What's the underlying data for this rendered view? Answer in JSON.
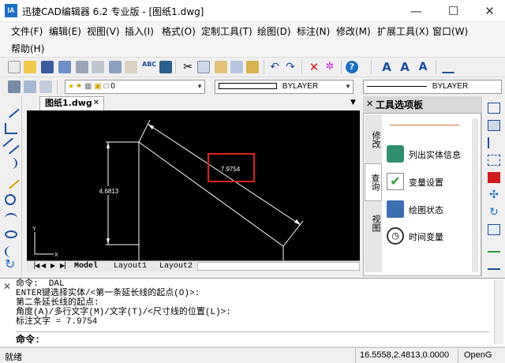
{
  "window": {
    "title": "迅捷CAD编辑器 6.2 专业版  - [图纸1.dwg]",
    "app_icon_text": "IA",
    "minimize": "—",
    "maximize": "☐",
    "close": "✕"
  },
  "menu": {
    "items": [
      "文件(F)",
      "编辑(E)",
      "视图(V)",
      "插入(I)",
      "格式(O)",
      "定制工具(T)",
      "绘图(D)",
      "标注(N)",
      "修改(M)",
      "扩展工具(X)",
      "窗口(W)",
      "帮助(H)"
    ]
  },
  "toolbar2": {
    "layer_value": "0",
    "color_value": "BYLAYER",
    "linetype_value": "BYLAYER"
  },
  "document": {
    "tab_label": "图纸1.dwg",
    "tab_close": "✕",
    "collapse_arrow": "▼"
  },
  "drawing": {
    "dim_vertical": "4.6813",
    "dim_aligned": "7.9754",
    "ucs_y": "Y",
    "ucs_x": "X"
  },
  "layout_tabs": [
    "Model",
    "Layout1",
    "Layout2"
  ],
  "palette": {
    "title": "工具选项板",
    "tabs": [
      "修改",
      "查询",
      "视图"
    ],
    "items": [
      {
        "label": "列出实体信息",
        "icon": "list-entity-icon"
      },
      {
        "label": "变量设置",
        "icon": "variable-check-icon"
      },
      {
        "label": "绘图状态",
        "icon": "drawing-status-icon"
      },
      {
        "label": "时间变量",
        "icon": "clock-icon"
      }
    ]
  },
  "command": {
    "history": [
      "命令:  DAL",
      "ENTER键选择实体/<第一条延长线的起点(O)>:",
      "第二条延长线的起点:",
      "角度(A)/多行文字(M)/文字(T)/<尺寸线的位置(L)>:",
      "标注文字 = 7.9754"
    ],
    "prompt": "命令:"
  },
  "status": {
    "state": "就绪",
    "coords": "16.5558,2.4813,0.0000",
    "renderer": "OpenG"
  },
  "colors": {
    "highlight_box": "#e02020",
    "accent_blue": "#1b6ec2"
  }
}
